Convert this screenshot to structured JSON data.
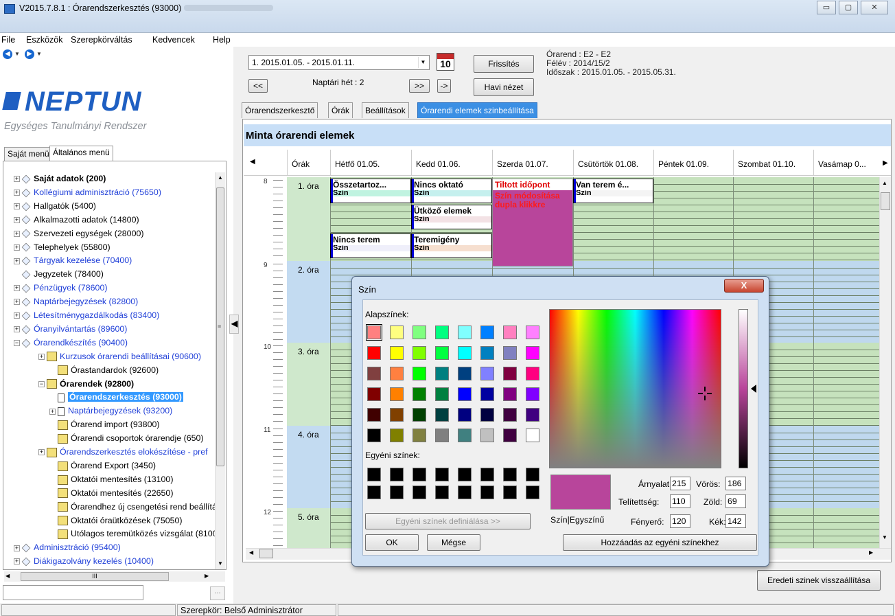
{
  "window": {
    "title": "V2015.7.8.1 : Órarendszerkesztés (93000)",
    "min": "▭",
    "max": "▢",
    "close": "✕"
  },
  "menu": [
    "File",
    "Eszközök",
    "Szerepkörváltás",
    "Kedvencek",
    "Help"
  ],
  "logo": {
    "title": "NEPTUN",
    "subtitle": "Egységes Tanulmányi Rendszer"
  },
  "left_tabs": [
    "Saját menü",
    "Általános menü"
  ],
  "tree": [
    {
      "label": "Saját adatok (200)",
      "bold": true,
      "blue": false
    },
    {
      "label": "Kollégiumi adminisztráció (75650)",
      "blue": true
    },
    {
      "label": "Hallgatók (5400)"
    },
    {
      "label": "Alkalmazotti adatok (14800)"
    },
    {
      "label": "Szervezeti egységek (28000)"
    },
    {
      "label": "Telephelyek (55800)"
    },
    {
      "label": "Tárgyak kezelése (70400)",
      "blue": true
    },
    {
      "label": "Jegyzetek (78400)"
    },
    {
      "label": "Pénzügyek (78600)",
      "blue": true
    },
    {
      "label": "Naptárbejegyzések (82800)",
      "blue": true
    },
    {
      "label": "Létesítménygazdálkodás (83400)",
      "blue": true
    },
    {
      "label": "Óranyilvántartás (89600)",
      "blue": true
    },
    {
      "label": "Órarendkészítés (90400)",
      "blue": true
    },
    {
      "label": "Kurzusok órarendi beállításai (90600)",
      "blue": true
    },
    {
      "label": "Órastandardok (92600)"
    },
    {
      "label": "Órarendek (92800)",
      "bold": true
    },
    {
      "label": "Órarendszerkesztés (93000)",
      "bold": true,
      "selected": true
    },
    {
      "label": "Naptárbejegyzések (93200)",
      "blue": true
    },
    {
      "label": "Órarend import (93800)"
    },
    {
      "label": "Órarendi csoportok órarendje (650)"
    },
    {
      "label": "Órarendszerkesztés elokészítése - pref",
      "blue": true
    },
    {
      "label": "Órarend Export (3450)"
    },
    {
      "label": "Oktatói mentesítés (13100)"
    },
    {
      "label": "Oktatói mentesítés (22650)"
    },
    {
      "label": "Órarendhez új csengetési rend beállítá"
    },
    {
      "label": "Oktatói óraütközések (75050)"
    },
    {
      "label": "Utólagos teremütközés vizsgálat (8100"
    },
    {
      "label": "Adminisztráció (95400)",
      "blue": true
    },
    {
      "label": "Diákigazolvány kezelés (10400)",
      "blue": true
    }
  ],
  "left_dots": "...",
  "hscroll_label": "III",
  "toolbar": {
    "week_value": "1. 2015.01.05. - 2015.01.11.",
    "cal_day": "10",
    "refresh": "Frissítés",
    "prev": "<<",
    "week_label": "Naptári hét : 2",
    "next": ">>",
    "arrow": "->",
    "monthly": "Havi nézet",
    "info": [
      "Órarend : E2 - E2",
      "Félév : 2014/15/2",
      "Időszak : 2015.01.05. - 2015.05.31."
    ]
  },
  "right_tabs": [
    "Órarendszerkesztő",
    "Órák",
    "Beállítások",
    "Órarendi elemek szinbeállítása"
  ],
  "grid": {
    "title": "Minta órarendi elemek",
    "columns": [
      "Órák",
      "Hétfő 01.05.",
      "Kedd 01.06.",
      "Szerda 01.07.",
      "Csütörtök 01.08.",
      "Péntek 01.09.",
      "Szombat 01.10.",
      "Vasámap 0..."
    ],
    "hours": [
      "1. óra",
      "2. óra",
      "3. óra",
      "4. óra",
      "5. óra"
    ],
    "hour_marks": [
      "8",
      "9",
      "10",
      "11",
      "12"
    ],
    "cells": [
      {
        "name": "Összetartoz...",
        "sub": "Szín",
        "color": "#c0f3e0"
      },
      {
        "name": "Nincs oktató",
        "sub": "Szín",
        "color": "#c5f0ee"
      },
      {
        "name": "Tiltott időpont",
        "sub": "Szín módosítása dupla klikkre",
        "color": "#b8459b"
      },
      {
        "name": "Van terem é...",
        "sub": "Szín",
        "color": "#f4f4f4"
      },
      {
        "name": "Ütköző elemek",
        "sub": "Szín",
        "color": "#f3e2e5"
      },
      {
        "name": "Nincs terem",
        "sub": "Szín",
        "color": "#efeffa"
      },
      {
        "name": "Teremigény",
        "sub": "Szín",
        "color": "#f6dfcf"
      }
    ],
    "restore": "Eredeti szinek visszaállítása"
  },
  "status": {
    "role": "Szerepkör: Belső Adminisztrátor"
  },
  "dialog": {
    "title": "Szín",
    "close": "X",
    "basic_label": "Alapszínek:",
    "custom_label": "Egyéni színek:",
    "define_custom": "Egyéni színek definiálása >>",
    "ok": "OK",
    "cancel": "Mégse",
    "add_custom": "Hozzáadás az egyéni színekhez",
    "solid_label": "Szín|Egyszínű",
    "hue_label": "Árnyalat:",
    "hue": "215",
    "sat_label": "Telítettség:",
    "sat": "110",
    "lum_label": "Fényerő:",
    "lum": "120",
    "red_label": "Vörös:",
    "red": "186",
    "green_label": "Zöld:",
    "green": "69",
    "blue_label": "Kék:",
    "blue": "142",
    "selected_color": "#b8459b",
    "basic_colors": [
      "#ff8080",
      "#ffff80",
      "#80ff80",
      "#00ff80",
      "#80ffff",
      "#0080ff",
      "#ff80c0",
      "#ff80ff",
      "#ff0000",
      "#ffff00",
      "#80ff00",
      "#00ff40",
      "#00ffff",
      "#0080c0",
      "#8080c0",
      "#ff00ff",
      "#804040",
      "#ff8040",
      "#00ff00",
      "#008080",
      "#004080",
      "#8080ff",
      "#800040",
      "#ff0080",
      "#800000",
      "#ff8000",
      "#008000",
      "#008040",
      "#0000ff",
      "#0000a0",
      "#800080",
      "#8000ff",
      "#400000",
      "#804000",
      "#004000",
      "#004040",
      "#000080",
      "#000040",
      "#400040",
      "#400080",
      "#000000",
      "#808000",
      "#808040",
      "#808080",
      "#408080",
      "#c0c0c0",
      "#400040",
      "#ffffff"
    ],
    "custom_colors": [
      "#000000",
      "#000000",
      "#000000",
      "#000000",
      "#000000",
      "#000000",
      "#000000",
      "#000000",
      "#000000",
      "#000000",
      "#000000",
      "#000000",
      "#000000",
      "#000000",
      "#000000",
      "#000000"
    ]
  }
}
